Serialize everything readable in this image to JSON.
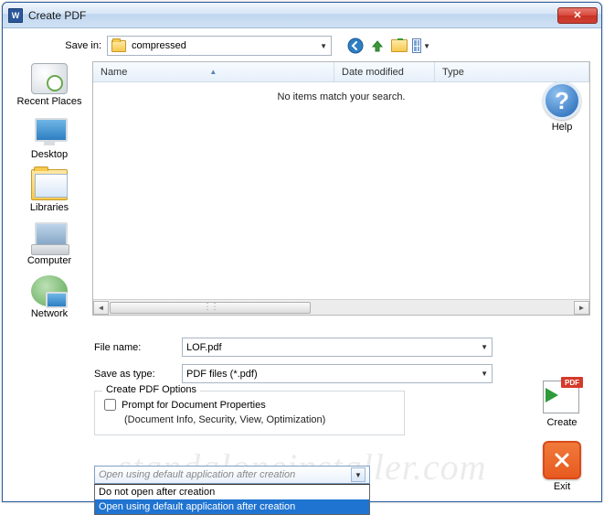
{
  "window": {
    "title": "Create PDF"
  },
  "savein": {
    "label": "Save in:",
    "value": "compressed"
  },
  "columns": {
    "name": "Name",
    "date": "Date modified",
    "type": "Type"
  },
  "listing": {
    "empty": "No items match your search."
  },
  "filename": {
    "label": "File name:",
    "value": "LOF.pdf"
  },
  "savetype": {
    "label": "Save as type:",
    "value": "PDF files (*.pdf)"
  },
  "options": {
    "legend": "Create PDF Options",
    "prompt": "Prompt for Document Properties",
    "prompt_sub": "(Document Info, Security, View, Optimization)"
  },
  "dropdown": {
    "selected_display": "Open using default application after creation",
    "items": [
      "Do not open after creation",
      "Open using default application after creation"
    ]
  },
  "places": {
    "recent": "Recent Places",
    "desktop": "Desktop",
    "libraries": "Libraries",
    "computer": "Computer",
    "network": "Network"
  },
  "buttons": {
    "help": "Help",
    "create": "Create",
    "exit": "Exit"
  },
  "watermark": "standaloneinstaller.com"
}
